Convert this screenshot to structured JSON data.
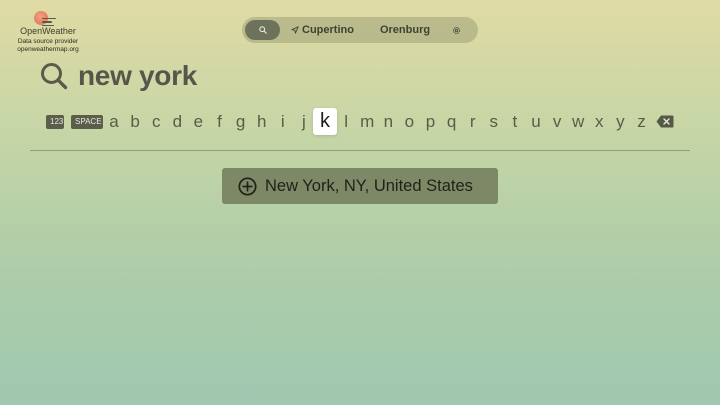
{
  "brand": {
    "name": "OpenWeather",
    "source_label": "Data source provider",
    "source_url": "openweathermap.org"
  },
  "nav": {
    "search_icon": "search-icon",
    "tabs": [
      {
        "label": "Cupertino",
        "icon": "location-arrow-icon"
      },
      {
        "label": "Orenburg"
      }
    ],
    "settings_icon": "gear-icon"
  },
  "search": {
    "icon": "search-icon",
    "query": "new york"
  },
  "keyboard": {
    "numbers_label": "123",
    "space_label": "SPACE",
    "letters": [
      "a",
      "b",
      "c",
      "d",
      "e",
      "f",
      "g",
      "h",
      "i",
      "j",
      "k",
      "l",
      "m",
      "n",
      "o",
      "p",
      "q",
      "r",
      "s",
      "t",
      "u",
      "v",
      "w",
      "x",
      "y",
      "z"
    ],
    "focused_letter": "k",
    "delete_icon": "backspace-icon"
  },
  "results": [
    {
      "label": "New York, NY, United States",
      "icon": "add-circle-icon"
    }
  ],
  "colors": {
    "accent": "#7d8866",
    "nav_active": "#6d735a",
    "logo_sun": "#e8795e"
  }
}
